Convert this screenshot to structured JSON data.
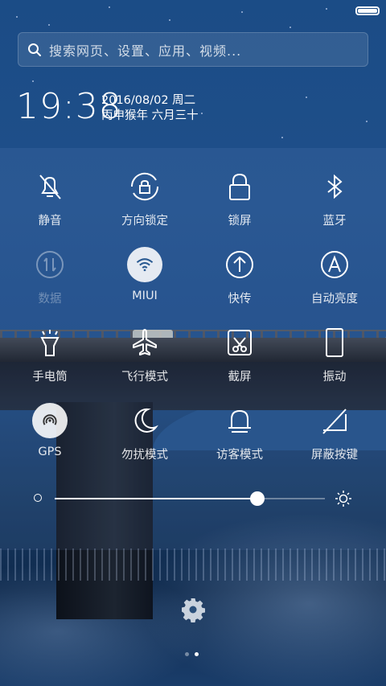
{
  "status": {
    "battery_level": 1.0
  },
  "search": {
    "placeholder": "搜索网页、设置、应用、视频..."
  },
  "clock": {
    "time": "19:38",
    "date": "2016/08/02 周二",
    "lunar": "丙申猴年 六月三十"
  },
  "toggles": [
    {
      "label": "静音",
      "icon": "bell-off-icon",
      "state": "off"
    },
    {
      "label": "方向锁定",
      "icon": "rotation-lock-icon",
      "state": "off"
    },
    {
      "label": "锁屏",
      "icon": "lock-icon",
      "state": "off"
    },
    {
      "label": "蓝牙",
      "icon": "bluetooth-icon",
      "state": "off"
    },
    {
      "label": "数据",
      "icon": "mobile-data-icon",
      "state": "disabled"
    },
    {
      "label": "MIUI",
      "icon": "wifi-icon",
      "state": "on"
    },
    {
      "label": "快传",
      "icon": "upload-icon",
      "state": "off"
    },
    {
      "label": "自动亮度",
      "icon": "auto-brightness-icon",
      "state": "off"
    },
    {
      "label": "手电筒",
      "icon": "flashlight-icon",
      "state": "off"
    },
    {
      "label": "飞行模式",
      "icon": "airplane-icon",
      "state": "off"
    },
    {
      "label": "截屏",
      "icon": "screenshot-icon",
      "state": "off"
    },
    {
      "label": "振动",
      "icon": "vibrate-icon",
      "state": "off"
    },
    {
      "label": "GPS",
      "icon": "gps-icon",
      "state": "on"
    },
    {
      "label": "勿扰模式",
      "icon": "moon-icon",
      "state": "off"
    },
    {
      "label": "访客模式",
      "icon": "guest-icon",
      "state": "off"
    },
    {
      "label": "屏蔽按键",
      "icon": "disable-keys-icon",
      "state": "off"
    }
  ],
  "brightness": {
    "level": 0.75
  },
  "pager": {
    "page_count": 2,
    "current_page": 2
  },
  "colors": {
    "accent": "#ffffff",
    "panel_tint": "#1d4a82",
    "active_toggle_bg": "#e6e6e6",
    "active_toggle_icon": "#2a5a92"
  }
}
